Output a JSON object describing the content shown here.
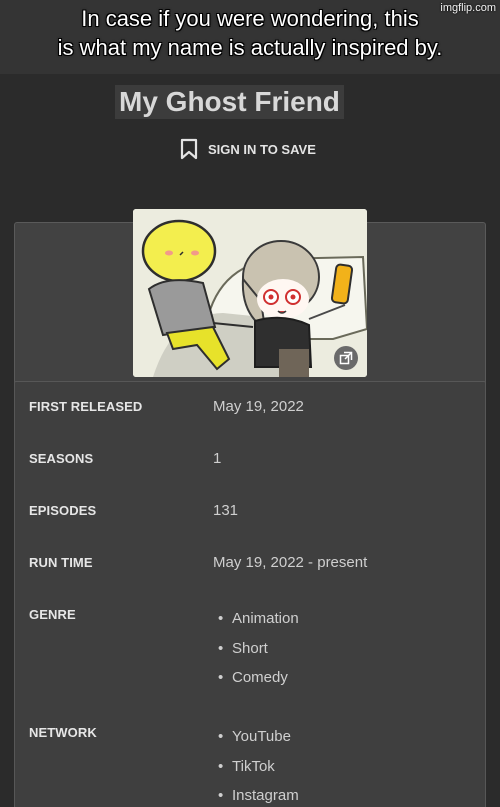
{
  "meme": {
    "caption": "In case if you were wondering, this\nis what my name is actually inspired by.",
    "watermark": "imgflip.com"
  },
  "show": {
    "title": "My Ghost Friend",
    "save_label": "SIGN IN TO SAVE"
  },
  "poster": {
    "expand_icon": "expand-icon"
  },
  "details": {
    "first_released": {
      "label": "FIRST RELEASED",
      "value": "May 19, 2022"
    },
    "seasons": {
      "label": "SEASONS",
      "value": "1"
    },
    "episodes": {
      "label": "EPISODES",
      "value": "131"
    },
    "run_time": {
      "label": "RUN TIME",
      "value": "May 19, 2022 - present"
    },
    "genre": {
      "label": "GENRE",
      "values": [
        "Animation",
        "Short",
        "Comedy"
      ]
    },
    "network": {
      "label": "NETWORK",
      "values": [
        "YouTube",
        "TikTok",
        "Instagram"
      ]
    }
  }
}
